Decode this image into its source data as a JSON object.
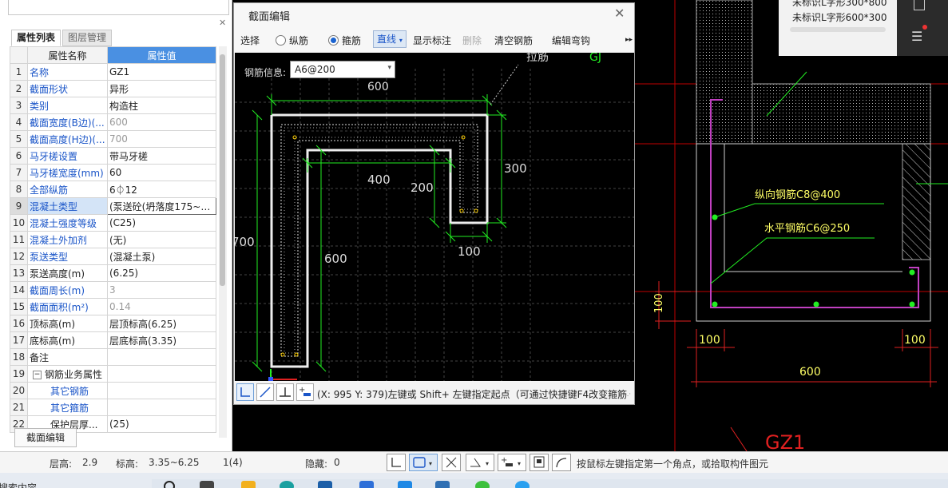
{
  "left_panel": {
    "tabs": [
      "属性列表",
      "图层管理"
    ],
    "columns": [
      "属性名称",
      "属性值"
    ],
    "rows": [
      {
        "n": "1",
        "name": "名称",
        "value": "GZ1",
        "blue": true,
        "gray": false
      },
      {
        "n": "2",
        "name": "截面形状",
        "value": "异形",
        "blue": true,
        "gray": false
      },
      {
        "n": "3",
        "name": "类别",
        "value": "构造柱",
        "blue": true,
        "gray": false
      },
      {
        "n": "4",
        "name": "截面宽度(B边)(...",
        "value": "600",
        "blue": true,
        "gray": true
      },
      {
        "n": "5",
        "name": "截面高度(H边)(...",
        "value": "700",
        "blue": true,
        "gray": true
      },
      {
        "n": "6",
        "name": "马牙槎设置",
        "value": "带马牙槎",
        "blue": true,
        "gray": false
      },
      {
        "n": "7",
        "name": "马牙槎宽度(mm)",
        "value": "60",
        "blue": true,
        "gray": false
      },
      {
        "n": "8",
        "name": "全部纵筋",
        "value": "6⏀12",
        "blue": true,
        "gray": false
      },
      {
        "n": "9",
        "name": "混凝土类型",
        "value": "(泵送砼(坍落度175~1...",
        "blue": true,
        "gray": false
      },
      {
        "n": "10",
        "name": "混凝土强度等级",
        "value": "(C25)",
        "blue": true,
        "gray": false
      },
      {
        "n": "11",
        "name": "混凝土外加剂",
        "value": "(无)",
        "blue": true,
        "gray": false
      },
      {
        "n": "12",
        "name": "泵送类型",
        "value": "(混凝土泵)",
        "blue": true,
        "gray": false
      },
      {
        "n": "13",
        "name": "泵送高度(m)",
        "value": "(6.25)",
        "blue": false,
        "gray": false
      },
      {
        "n": "14",
        "name": "截面周长(m)",
        "value": "3",
        "blue": true,
        "gray": true
      },
      {
        "n": "15",
        "name": "截面面积(m²)",
        "value": "0.14",
        "blue": true,
        "gray": true
      },
      {
        "n": "16",
        "name": "顶标高(m)",
        "value": "层顶标高(6.25)",
        "blue": false,
        "gray": false
      },
      {
        "n": "17",
        "name": "底标高(m)",
        "value": "层底标高(3.35)",
        "blue": false,
        "gray": false
      },
      {
        "n": "18",
        "name": "备注",
        "value": "",
        "blue": false,
        "gray": false
      },
      {
        "n": "19",
        "name": "钢筋业务属性",
        "value": "",
        "blue": false,
        "gray": false
      },
      {
        "n": "20",
        "name": "其它钢筋",
        "value": "",
        "blue": true,
        "gray": false
      },
      {
        "n": "21",
        "name": "其它箍筋",
        "value": "",
        "blue": true,
        "gray": false
      },
      {
        "n": "22",
        "name": "保护层厚...",
        "value": "(25)",
        "blue": false,
        "gray": false
      }
    ],
    "edit_button": "截面编辑"
  },
  "dialog": {
    "title": "截面编辑",
    "toolbar": {
      "select": "选择",
      "longitudinal": "纵筋",
      "stirrup": "箍筋",
      "line": "直线",
      "show_annotation": "显示标注",
      "delete": "删除",
      "clear_rebar": "清空钢筋",
      "edit_hook": "编辑弯钩",
      "more": "▸▸"
    },
    "rebar_info_label": "钢筋信息:",
    "rebar_info_value": "A6@200",
    "canvas_labels": {
      "top_partial": "600",
      "annot_tr": "拉筋",
      "annot_gj": "GJ",
      "d400": "400",
      "d200": "200",
      "d300": "300",
      "d700": "700",
      "d600": "600",
      "d100": "100"
    },
    "hint": "(X: 995 Y: 379)左键或 Shift+ 左键指定起点（可通过快捷键F4改变箍筋"
  },
  "cad": {
    "popup_items": [
      "未标识L字形300*800",
      "未标识L字形600*300"
    ],
    "label_1": "纵向钢筋C8@400",
    "label_2": "水平钢筋C6@250",
    "dim_100_v": "100",
    "dim_100_l": "100",
    "dim_100_r": "100",
    "dim_600": "600",
    "gz_label": "GZ1"
  },
  "status": {
    "floor_height_label": "层高:",
    "floor_height": "2.9",
    "elev_label": "标高:",
    "elev": "3.35~6.25",
    "count": "1(4)",
    "hidden_label": "隐藏:",
    "hidden": "0",
    "hint": "按鼠标左键指定第一个角点，或拾取构件图元"
  },
  "taskbar": {
    "left_text": "搜索内容"
  }
}
